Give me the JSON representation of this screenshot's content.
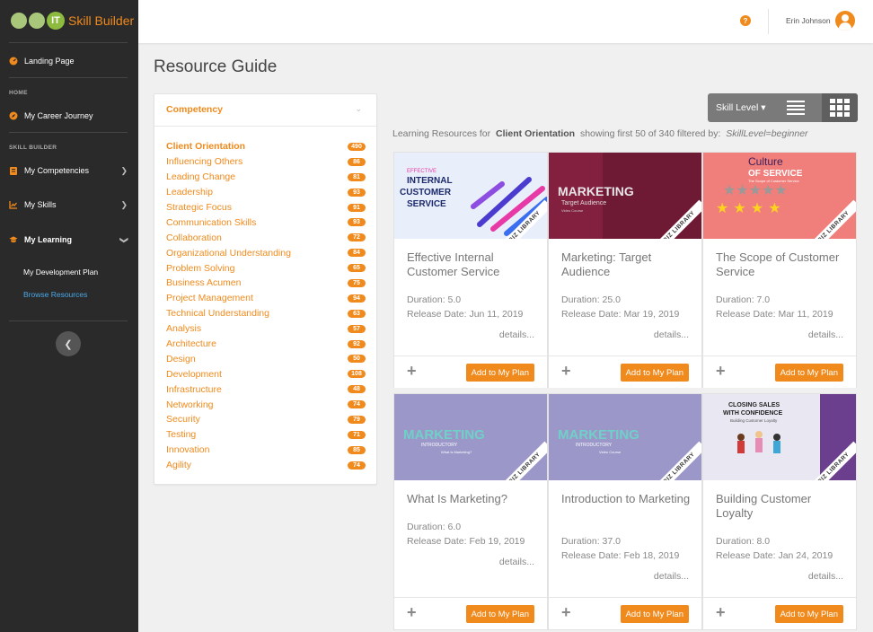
{
  "sidebar": {
    "logo_it": "IT",
    "logo_text": "Skill Builder",
    "landing": "Landing Page",
    "section_home": "HOME",
    "career": "My Career Journey",
    "section_skill": "SKILL BUILDER",
    "competencies": "My Competencies",
    "skills": "My Skills",
    "learning": "My Learning",
    "dev_plan": "My Development Plan",
    "browse": "Browse Resources"
  },
  "topbar": {
    "help": "?",
    "user_name": "Erin Johnson"
  },
  "page_title": "Resource Guide",
  "competency": {
    "title": "Competency",
    "items": [
      {
        "name": "Client Orientation",
        "count": "490"
      },
      {
        "name": "Influencing Others",
        "count": "86"
      },
      {
        "name": "Leading Change",
        "count": "81"
      },
      {
        "name": "Leadership",
        "count": "93"
      },
      {
        "name": "Strategic Focus",
        "count": "91"
      },
      {
        "name": "Communication Skills",
        "count": "93"
      },
      {
        "name": "Collaboration",
        "count": "72"
      },
      {
        "name": "Organizational Understanding",
        "count": "84"
      },
      {
        "name": "Problem Solving",
        "count": "65"
      },
      {
        "name": "Business Acumen",
        "count": "75"
      },
      {
        "name": "Project Management",
        "count": "94"
      },
      {
        "name": "Technical Understanding",
        "count": "63"
      },
      {
        "name": "Analysis",
        "count": "57"
      },
      {
        "name": "Architecture",
        "count": "92"
      },
      {
        "name": "Design",
        "count": "50"
      },
      {
        "name": "Development",
        "count": "108"
      },
      {
        "name": "Infrastructure",
        "count": "48"
      },
      {
        "name": "Networking",
        "count": "74"
      },
      {
        "name": "Security",
        "count": "79"
      },
      {
        "name": "Testing",
        "count": "71"
      },
      {
        "name": "Innovation",
        "count": "85"
      },
      {
        "name": "Agility",
        "count": "74"
      }
    ]
  },
  "toolbar": {
    "skill_level": "Skill Level ▾"
  },
  "results": {
    "prefix": "Learning Resources for",
    "topic": "Client Orientation",
    "summary": "showing first 50 of 340 filtered by:",
    "filter": "SkillLevel=beginner"
  },
  "cards": [
    {
      "title": "Effective Internal Customer Service",
      "duration": "Duration: 5.0",
      "release": "Release Date: Jun 11, 2019",
      "details": "details...",
      "add": "Add to My Plan",
      "thumb_lines": [
        "EFFECTIVE",
        "INTERNAL",
        "CUSTOMER",
        "SERVICE"
      ]
    },
    {
      "title": "Marketing: Target Audience",
      "duration": "Duration: 25.0",
      "release": "Release Date: Mar 19, 2019",
      "details": "details...",
      "add": "Add to My Plan",
      "thumb_lines": [
        "MARKETING",
        "Target Audience",
        "Video Course"
      ]
    },
    {
      "title": "The Scope of Customer Service",
      "duration": "Duration: 7.0",
      "release": "Release Date: Mar 11, 2019",
      "details": "details...",
      "add": "Add to My Plan",
      "thumb_lines": [
        "Culture",
        "OF SERVICE",
        "The Scope of Customer Service"
      ]
    },
    {
      "title": "What Is Marketing?",
      "duration": "Duration: 6.0",
      "release": "Release Date: Feb 19, 2019",
      "details": "details...",
      "add": "Add to My Plan",
      "thumb_lines": [
        "MARKETING",
        "INTRODUCTORY",
        "What is Marketing?"
      ]
    },
    {
      "title": "Introduction to Marketing",
      "duration": "Duration: 37.0",
      "release": "Release Date: Feb 18, 2019",
      "details": "details...",
      "add": "Add to My Plan",
      "thumb_lines": [
        "MARKETING",
        "INTRODUCTORY",
        "Video Course"
      ]
    },
    {
      "title": "Building Customer Loyalty",
      "duration": "Duration: 8.0",
      "release": "Release Date: Jan 24, 2019",
      "details": "details...",
      "add": "Add to My Plan",
      "thumb_lines": [
        "CLOSING SALES",
        "WITH CONFIDENCE",
        "Building Customer Loyalty"
      ]
    }
  ],
  "biz_label": "BIZ LIBRARY"
}
